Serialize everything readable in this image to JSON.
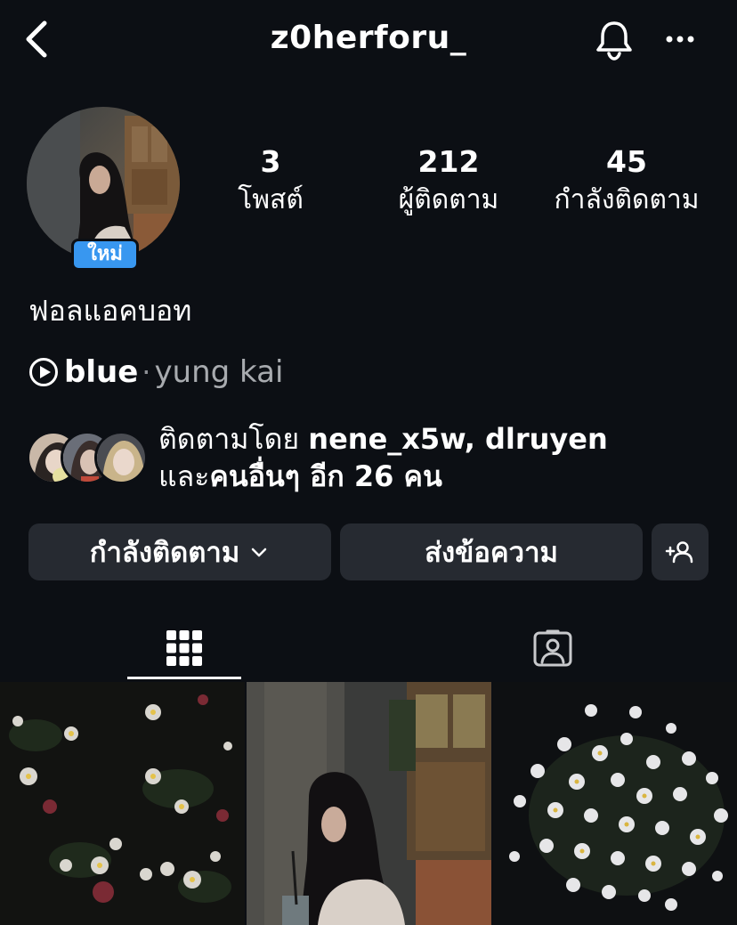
{
  "header": {
    "username": "z0herforu_",
    "back_icon": "chevron-left-icon",
    "bell_icon": "bell-icon",
    "more_icon": "more-horizontal-icon"
  },
  "profile": {
    "new_badge": "ใหม่",
    "bio_name": "ฟอลแอคบอท"
  },
  "stats": {
    "posts": {
      "count": "3",
      "label": "โพสต์"
    },
    "followers": {
      "count": "212",
      "label": "ผู้ติดตาม"
    },
    "following": {
      "count": "45",
      "label": "กำลังติดตาม"
    }
  },
  "music": {
    "icon": "play-circle-icon",
    "song": "blue",
    "separator": "·",
    "artist": "yung kai"
  },
  "followed_by": {
    "prefix": "ติดตามโดย",
    "names": "nene_x5w, dlruyen",
    "line2_prefix": "และ",
    "others": "คนอื่นๆ อีก 26 คน"
  },
  "buttons": {
    "following": "กำลังติดตาม",
    "message": "ส่งข้อความ",
    "add_user_icon": "add-user-icon"
  },
  "tabs": {
    "grid_icon": "grid-icon",
    "tagged_icon": "tagged-person-icon",
    "active": "grid"
  },
  "colors": {
    "background": "#0c0f14",
    "button": "#262a31",
    "badge": "#3897f0",
    "secondary_text": "#a8abaf"
  }
}
